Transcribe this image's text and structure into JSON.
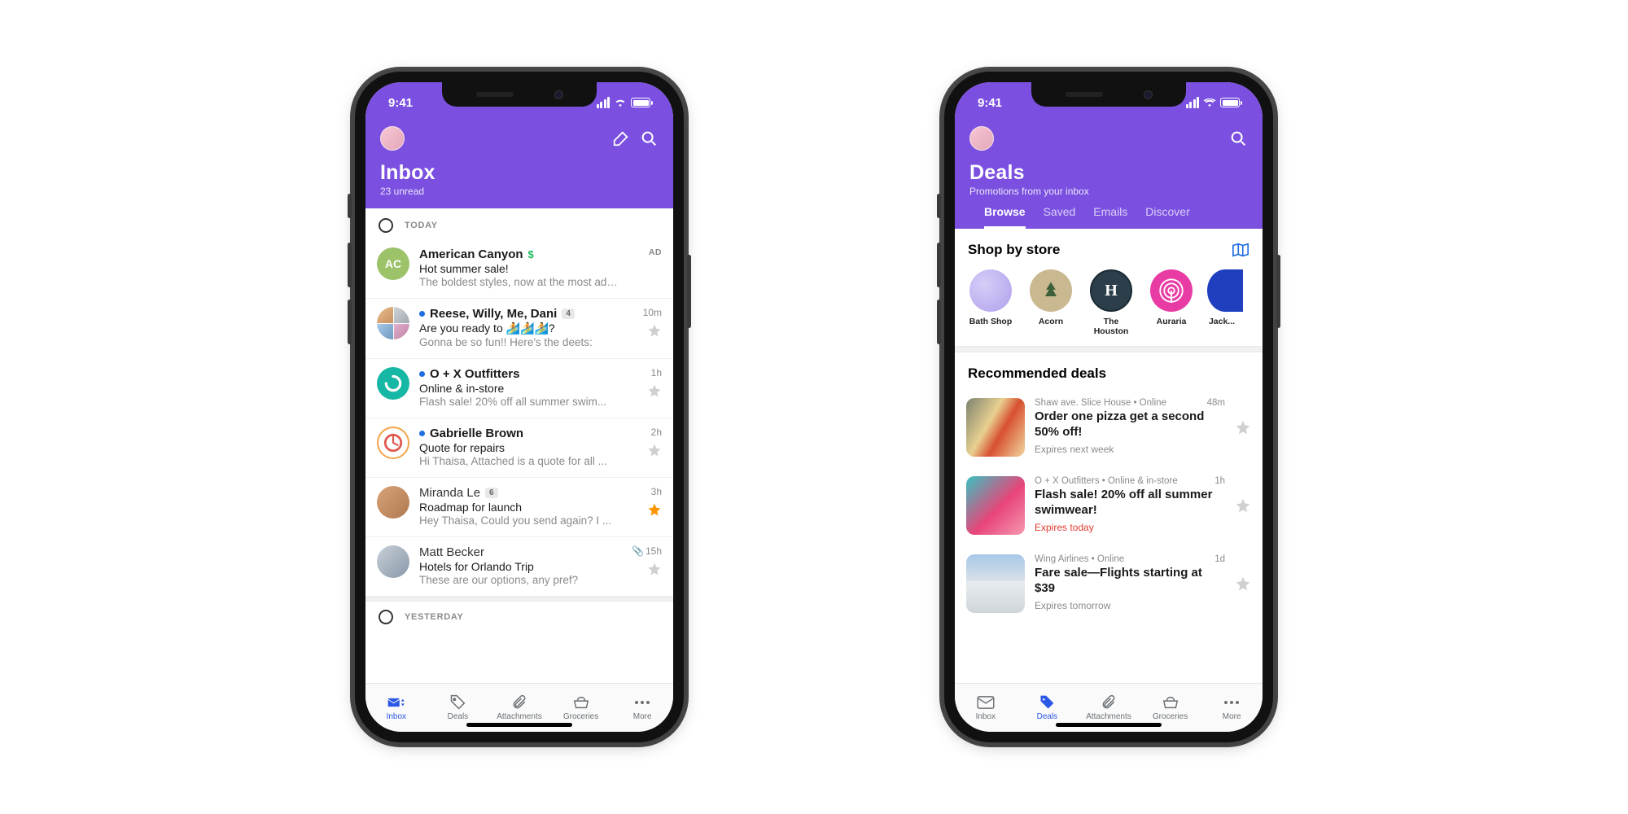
{
  "status": {
    "time": "9:41"
  },
  "colors": {
    "accent": "#7b50e0",
    "blue": "#2b58e6"
  },
  "left": {
    "header": {
      "title": "Inbox",
      "subtitle": "23 unread"
    },
    "sections": {
      "today": "TODAY",
      "yesterday": "YESTERDAY"
    },
    "ad": {
      "sender": "American Canyon",
      "subject": "Hot summer sale!",
      "preview": "The boldest styles, now at the most adven...",
      "tag": "AD",
      "avatar_text": "AC"
    },
    "messages": [
      {
        "unread": true,
        "sender": "Reese, Willy, Me, Dani",
        "count": "4",
        "subject": "Are you ready to 🏄🏄🏄?",
        "preview": "Gonna be so fun!! Here's the deets:",
        "time": "10m",
        "starred": false,
        "avatar": "quad"
      },
      {
        "unread": true,
        "sender": "O + X Outfitters",
        "subject": "Online & in-store",
        "preview": "Flash sale! 20% off all summer swim...",
        "time": "1h",
        "starred": false,
        "avatar": "teal"
      },
      {
        "unread": true,
        "sender": "Gabrielle Brown",
        "subject": "Quote for repairs",
        "preview": "Hi Thaisa, Attached is a quote for all ...",
        "time": "2h",
        "starred": false,
        "avatar": "orange"
      },
      {
        "unread": false,
        "sender": "Miranda Le",
        "count": "6",
        "subject": "Roadmap for launch",
        "preview": "Hey Thaisa, Could you send again? I ...",
        "time": "3h",
        "starred": true,
        "avatar": "photo1"
      },
      {
        "unread": false,
        "sender": "Matt Becker",
        "subject": "Hotels for Orlando Trip",
        "preview": "These are our options, any pref?",
        "time": "15h",
        "attach": true,
        "starred": false,
        "avatar": "photo2"
      }
    ],
    "tabs": [
      "Inbox",
      "Deals",
      "Attachments",
      "Groceries",
      "More"
    ]
  },
  "right": {
    "header": {
      "title": "Deals",
      "subtitle": "Promotions from your inbox"
    },
    "tabs": [
      "Browse",
      "Saved",
      "Emails",
      "Discover"
    ],
    "shop_header": "Shop by store",
    "stores": [
      {
        "name": "Bath Shop",
        "bg": "#b5a8f2"
      },
      {
        "name": "Acorn",
        "bg": "#c9b890"
      },
      {
        "name": "The Houston",
        "bg": "#2b3e4a",
        "letter": "H"
      },
      {
        "name": "Auraria",
        "bg": "#e83ba4"
      },
      {
        "name": "Jack...",
        "bg": "#1f3fbf"
      }
    ],
    "rec_header": "Recommended deals",
    "deals": [
      {
        "meta": "Shaw ave. Slice House • Online",
        "time": "48m",
        "title": "Order one pizza get a second 50% off!",
        "expires": "Expires next week",
        "urgent": false,
        "img": "pizza"
      },
      {
        "meta": "O + X Outfitters • Online & in-store",
        "time": "1h",
        "title": "Flash sale! 20% off all summer swimwear!",
        "expires": "Expires today",
        "urgent": true,
        "img": "swim"
      },
      {
        "meta": "Wing Airlines • Online",
        "time": "1d",
        "title": "Fare sale—Flights starting at $39",
        "expires": "Expires tomorrow",
        "urgent": false,
        "img": "plane"
      }
    ],
    "bottom_tabs": [
      "Inbox",
      "Deals",
      "Attachments",
      "Groceries",
      "More"
    ]
  }
}
